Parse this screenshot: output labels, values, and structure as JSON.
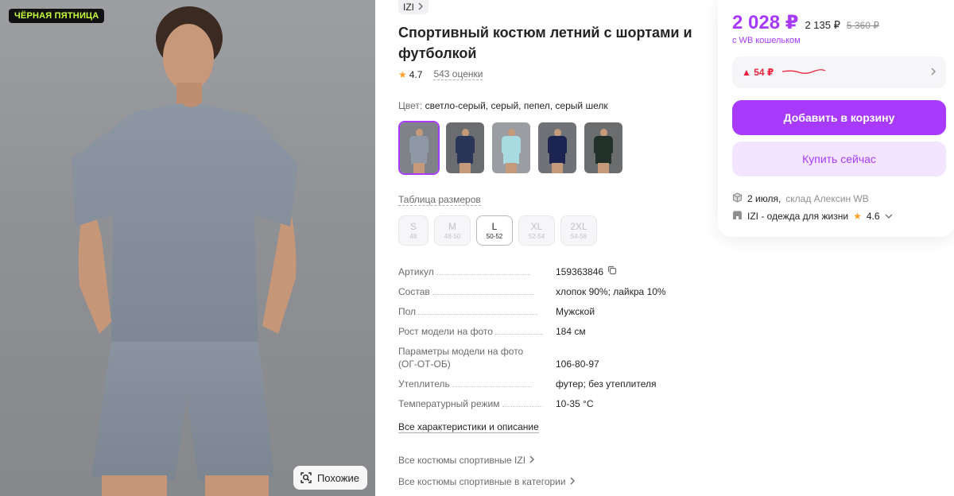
{
  "photo": {
    "promo_badge": "ЧЁРНАЯ ПЯТНИЦА",
    "similar_label": "Похожие"
  },
  "product": {
    "brand": "IZI",
    "title": "Спортивный костюм летний с шортами и футболкой",
    "rating": "4.7",
    "reviews": "543 оценки",
    "color_label": "Цвет:",
    "color_value": "светло-серый, серый, пепел, серый шелк",
    "size_table_link": "Таблица размеров",
    "sizes": [
      {
        "label": "S",
        "range": "48"
      },
      {
        "label": "M",
        "range": "48-50"
      },
      {
        "label": "L",
        "range": "50-52"
      },
      {
        "label": "XL",
        "range": "52-54"
      },
      {
        "label": "2XL",
        "range": "54-56"
      }
    ],
    "selected_size": "L",
    "swatch_colors": [
      {
        "bg": "#7f8388",
        "shirt": "#8e98a6",
        "shorts": "#8e98a6"
      },
      {
        "bg": "#6a6c70",
        "shirt": "#2b3558",
        "shorts": "#2b3558"
      },
      {
        "bg": "#9a9ea2",
        "shirt": "#a8dbe0",
        "shorts": "#a8dbe0"
      },
      {
        "bg": "#6f7276",
        "shirt": "#1c2452",
        "shorts": "#1c2452"
      },
      {
        "bg": "#6a6c6e",
        "shirt": "#22302a",
        "shorts": "#22302a"
      }
    ]
  },
  "specs": [
    {
      "key": "Артикул",
      "value": "159363846",
      "copy": true
    },
    {
      "key": "Состав",
      "value": "хлопок 90%; лайкра 10%"
    },
    {
      "key": "Пол",
      "value": "Мужской"
    },
    {
      "key": "Рост модели на фото",
      "value": "184 см"
    },
    {
      "key": "Параметры модели на фото (ОГ-ОТ-ОБ)",
      "value": "106-80-97",
      "multi": true
    },
    {
      "key": "Утеплитель",
      "value": "футер; без утеплителя"
    },
    {
      "key": "Температурный режим",
      "value": "10-35 °С"
    }
  ],
  "links": {
    "all_specs": "Все характеристики и описание",
    "all_brand_suits": "Все костюмы спортивные IZI",
    "all_category_suits": "Все костюмы спортивные в категории"
  },
  "buy": {
    "price": "2 028 ₽",
    "price_secondary": "2 135 ₽",
    "price_old": "5 360 ₽",
    "wallet_note": "с WB кошельком",
    "price_delta": "▲ 54 ₽",
    "add_to_cart": "Добавить в корзину",
    "buy_now": "Купить сейчас",
    "delivery_date": "2 июля,",
    "warehouse": "склад Алексин WB",
    "seller": "IZI - одежда для жизни",
    "seller_rating": "4.6"
  },
  "colors": {
    "accent": "#a73afd",
    "accent_light": "#f3e4ff",
    "red": "#f0223b",
    "star": "#ff9f29"
  }
}
